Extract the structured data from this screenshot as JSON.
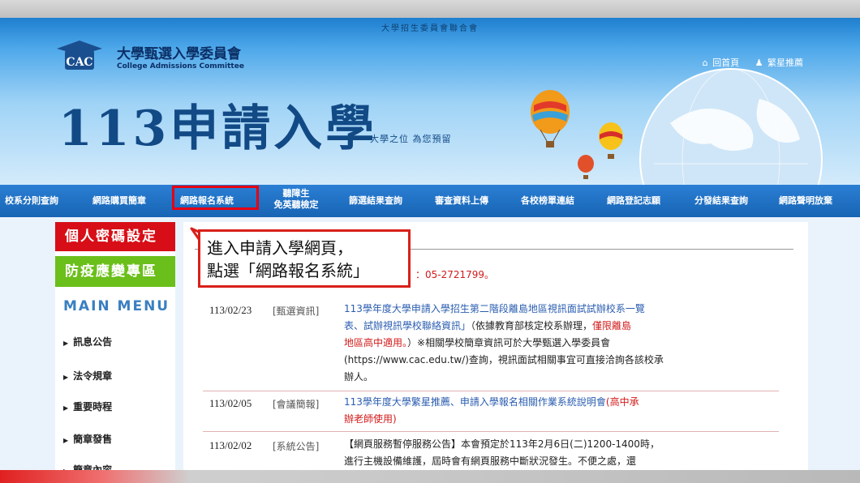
{
  "header": {
    "topbar_text": "大學招生委員會聯合會",
    "org_name": "大學甄選入學委員會",
    "org_name_en": "College Admissions Committee",
    "logo_text": "CAC",
    "links": [
      "回首頁",
      "繁星推薦"
    ],
    "big_title": "113申請入學",
    "tagline": "大學之位 為您預留"
  },
  "nav": {
    "items": [
      "校系分則查詢",
      "網路購買簡章",
      "網路報名系統",
      "聽障生",
      "免英聽檢定",
      "篩選結果查詢",
      "審查資料上傳",
      "各校榜單連結",
      "網路登記志願",
      "分發結果查詢",
      "網路聲明放棄"
    ]
  },
  "sidebar": {
    "personal_password": "個人密碼設定",
    "epidemic": "防疫應變專區",
    "main_menu": "MAIN MENU",
    "items": [
      "訊息公告",
      "法令規章",
      "重要時程",
      "簡章發售",
      "簡章內容"
    ]
  },
  "main": {
    "phone_text": "：05-2721799。",
    "news": [
      {
        "date": "113/02/23",
        "category": "[甄選資訊]",
        "title": "113學年度大學申請入學招生第二階段離島地區視訊面試試辦校系一覽表、試辦視訊學校聯絡資訊」",
        "line1": "113學年度大學申請入學招生第二階段離島地區視訊面試試辦校系一覽",
        "line2a": "表、試辦視訊學校聯絡資訊」",
        "line2b": "（依據教育部核定校系辦理，",
        "line2c": "僅限離島",
        "line3a": "地區高中適用。",
        "line3b": "）※相關學校簡章資訊可於大學甄選入學委員會",
        "line4": "(https://www.cac.edu.tw/)查詢，視訊面試相關事宜可直接洽詢各該校承",
        "line5": "辦人。"
      },
      {
        "date": "113/02/05",
        "category": "[會議簡報]",
        "line1a": "113學年度大學繁星推薦、申請入學報名相關作業系統說明會",
        "line1b": "(高中承",
        "line2": "辦老師使用)"
      },
      {
        "date": "113/02/02",
        "category": "[系統公告]",
        "line1": "【網頁服務暫停服務公告】本會預定於113年2月6日(二)1200-1400時，",
        "line2": "進行主機設備維護，屆時會有網頁服務中斷狀況發生。不便之處，還"
      }
    ]
  },
  "callout": {
    "line1": "進入申請入學網頁，",
    "line2": "點選「網路報名系統」"
  },
  "colors": {
    "nav_blue": "#1f6fc4",
    "highlight_red": "#e60012",
    "btn_red": "#d70e17",
    "btn_green": "#6bbf1a"
  }
}
